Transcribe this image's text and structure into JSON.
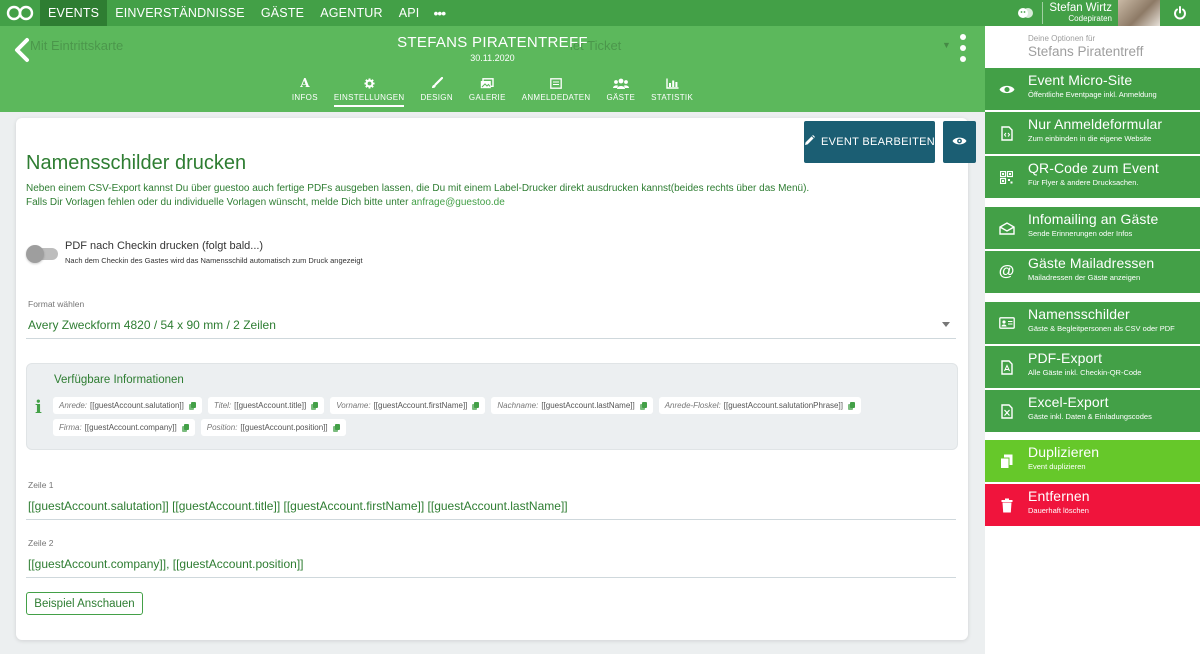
{
  "topnav": {
    "items": [
      "EVENTS",
      "EINVERSTÄNDNISSE",
      "GÄSTE",
      "AGENTUR",
      "API"
    ],
    "more": "•••",
    "user_name": "Stefan Wirtz",
    "user_org": "Codepiraten"
  },
  "event": {
    "title": "STEFANS PIRATENTREFF",
    "date": "30.11.2020",
    "ghost_left": "Mit Eintrittskarte",
    "ghost_right": "iet Ticket",
    "tabs": [
      {
        "label": "INFOS",
        "icon": "font-icon"
      },
      {
        "label": "EINSTELLUNGEN",
        "icon": "gear-icon"
      },
      {
        "label": "DESIGN",
        "icon": "brush-icon"
      },
      {
        "label": "GALERIE",
        "icon": "gallery-icon"
      },
      {
        "label": "ANMELDEDATEN",
        "icon": "form-icon"
      },
      {
        "label": "GÄSTE",
        "icon": "users-icon"
      },
      {
        "label": "STATISTIK",
        "icon": "chart-icon"
      }
    ],
    "active_tab": "EINSTELLUNGEN"
  },
  "card": {
    "edit_button": "EVENT BEARBEITEN",
    "title": "Namensschilder drucken",
    "intro_line1": "Neben einem CSV-Export kannst Du über guestoo auch fertige PDFs ausgeben lassen, die Du mit einem Label-Drucker direkt ausdrucken kannst(beides rechts über das Menü).",
    "intro_line2": "Falls Dir Vorlagen fehlen oder du individuelle Vorlagen wünscht, melde Dich bitte unter",
    "intro_email": "anfrage@guestoo.de",
    "toggle_label": "PDF nach Checkin drucken (folgt bald...)",
    "toggle_sub": "Nach dem Checkin des Gastes wird das Namensschild automatisch zum Druck angezeigt",
    "toggle_on": false,
    "format_label": "Format wählen",
    "format_value": "Avery Zweckform 4820 / 54 x 90 mm / 2 Zeilen",
    "info_title": "Verfügbare Informationen",
    "chips": [
      {
        "key": "Anrede:",
        "value": "[[guestAccount.salutation]]"
      },
      {
        "key": "Titel:",
        "value": "[[guestAccount.title]]"
      },
      {
        "key": "Vorname:",
        "value": "[[guestAccount.firstName]]"
      },
      {
        "key": "Nachname:",
        "value": "[[guestAccount.lastName]]"
      },
      {
        "key": "Anrede-Floskel:",
        "value": "[[guestAccount.salutationPhrase]]"
      },
      {
        "key": "Firma:",
        "value": "[[guestAccount.company]]"
      },
      {
        "key": "Position:",
        "value": "[[guestAccount.position]]"
      }
    ],
    "zeile1_label": "Zeile 1",
    "zeile1_value": "[[guestAccount.salutation]] [[guestAccount.title]] [[guestAccount.firstName]] [[guestAccount.lastName]]",
    "zeile2_label": "Zeile 2",
    "zeile2_value": "[[guestAccount.company]], [[guestAccount.position]]",
    "example_button": "Beispiel Anschauen"
  },
  "sidebar": {
    "head_small": "Deine Optionen für",
    "head_big": "Stefans Piratentreff",
    "items": [
      {
        "title": "Event Micro-Site",
        "sub": "Öffentliche Eventpage inkl. Anmeldung",
        "icon": "eye-icon",
        "color": "#43a047"
      },
      {
        "title": "Nur Anmeldeformular",
        "sub": "Zum einbinden in die eigene Website",
        "icon": "code-file-icon",
        "color": "#43a047"
      },
      {
        "title": "QR-Code zum Event",
        "sub": "Für Flyer & andere Drucksachen.",
        "icon": "qrcode-icon",
        "color": "#43a047"
      },
      {
        "title": "Infomailing an Gäste",
        "sub": "Sende Erinnerungen oder Infos",
        "icon": "envelope-icon",
        "color": "#43a047"
      },
      {
        "title": "Gäste Mailadressen",
        "sub": "Mailadressen der Gäste anzeigen",
        "icon": "at-icon",
        "color": "#43a047"
      },
      {
        "title": "Namensschilder",
        "sub": "Gäste & Begleitpersonen als CSV oder PDF",
        "icon": "id-card-icon",
        "color": "#43a047"
      },
      {
        "title": "PDF-Export",
        "sub": "Alle Gäste inkl. Checkin-QR-Code",
        "icon": "pdf-file-icon",
        "color": "#43a047"
      },
      {
        "title": "Excel-Export",
        "sub": "Gäste inkl. Daten & Einladungscodes",
        "icon": "excel-file-icon",
        "color": "#43a047"
      },
      {
        "title": "Duplizieren",
        "sub": "Event duplizieren",
        "icon": "copy-icon",
        "color": "#66c82a"
      },
      {
        "title": "Entfernen",
        "sub": "Dauerhaft löschen",
        "icon": "trash-icon",
        "color": "#f0143c"
      }
    ]
  }
}
